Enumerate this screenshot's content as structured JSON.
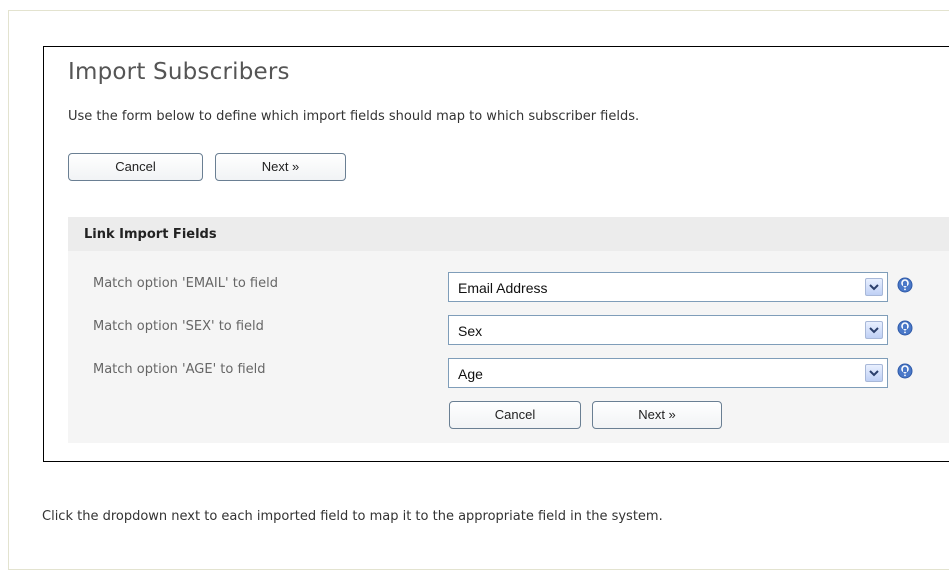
{
  "page": {
    "title": "Import Subscribers",
    "intro": "Use the form below to define which import fields should map to which subscriber fields."
  },
  "top_buttons": {
    "cancel_label": "Cancel",
    "next_label": "Next »"
  },
  "section": {
    "title": "Link Import Fields",
    "rows": [
      {
        "label": "Match option 'EMAIL' to field",
        "selected": "Email Address",
        "help_icon": "question-circle-icon"
      },
      {
        "label": "Match option 'SEX' to field",
        "selected": "Sex",
        "help_icon": "question-circle-icon"
      },
      {
        "label": "Match option 'AGE' to field",
        "selected": "Age",
        "help_icon": "question-circle-icon"
      }
    ]
  },
  "bottom_buttons": {
    "cancel_label": "Cancel",
    "next_label": "Next »"
  },
  "footer_note": "Click the dropdown next to each imported field to map it to the appropriate field in the system.",
  "colors": {
    "panel_border": "#000000",
    "section_bg": "#f5f5f5",
    "section_header_bg": "#ececec",
    "select_border": "#7f9db9",
    "button_border": "#6a7f93",
    "help_icon": "#4a78c8"
  }
}
